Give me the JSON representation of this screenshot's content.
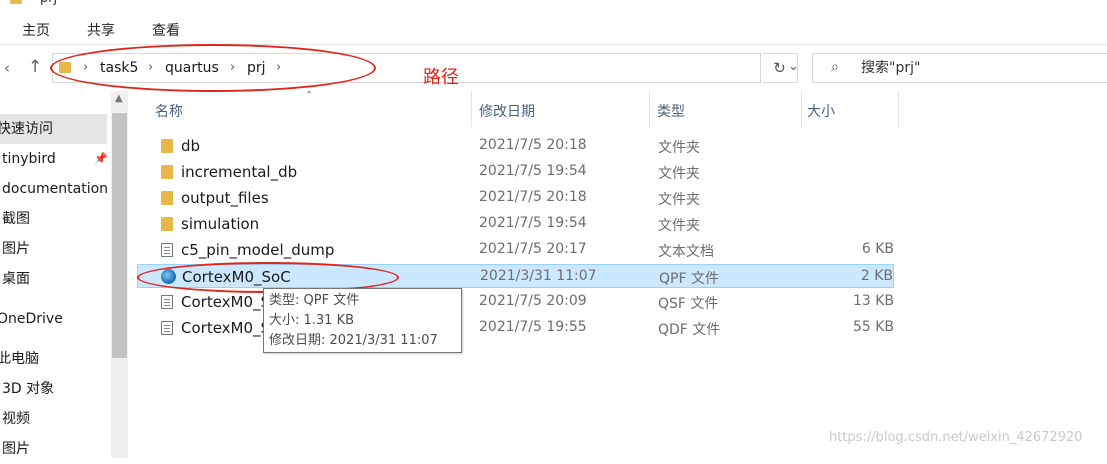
{
  "window": {
    "title": "prj"
  },
  "ribbon": {
    "tabs": [
      "主页",
      "共享",
      "查看"
    ]
  },
  "nav": {
    "back": "‹",
    "up": "↑"
  },
  "address": {
    "crumbs": [
      "task5",
      "quartus",
      "prj"
    ],
    "separator": "›",
    "dropdown": "⌄",
    "refresh": "↻"
  },
  "search": {
    "placeholder": "搜索\"prj\"",
    "icon": "search-icon"
  },
  "annotation": {
    "label": "路径",
    "color": "#e0251b"
  },
  "sidebar": {
    "items": [
      {
        "label": "快速访问",
        "selected": true
      },
      {
        "label": "tinybird",
        "pinned": true
      },
      {
        "label": "documentation"
      },
      {
        "label": "截图"
      },
      {
        "label": "图片"
      },
      {
        "label": "桌面"
      },
      {
        "label": "OneDrive"
      },
      {
        "label": "此电脑"
      },
      {
        "label": "3D 对象"
      },
      {
        "label": "视频"
      },
      {
        "label": "图片"
      }
    ]
  },
  "columns": {
    "name": "名称",
    "date": "修改日期",
    "type": "类型",
    "size": "大小"
  },
  "files": [
    {
      "name": "db",
      "date": "2021/7/5 20:18",
      "type": "文件夹",
      "size": "",
      "icon": "folder"
    },
    {
      "name": "incremental_db",
      "date": "2021/7/5 19:54",
      "type": "文件夹",
      "size": "",
      "icon": "folder"
    },
    {
      "name": "output_files",
      "date": "2021/7/5 20:18",
      "type": "文件夹",
      "size": "",
      "icon": "folder"
    },
    {
      "name": "simulation",
      "date": "2021/7/5 19:54",
      "type": "文件夹",
      "size": "",
      "icon": "folder"
    },
    {
      "name": "c5_pin_model_dump",
      "date": "2021/7/5 20:17",
      "type": "文本文档",
      "size": "6 KB",
      "icon": "doc"
    },
    {
      "name": "CortexM0_SoC",
      "date": "2021/3/31 11:07",
      "type": "QPF 文件",
      "size": "2 KB",
      "icon": "qpf",
      "selected": true
    },
    {
      "name": "CortexM0_S",
      "date": "2021/7/5 20:09",
      "type": "QSF 文件",
      "size": "13 KB",
      "icon": "doc"
    },
    {
      "name": "CortexM0_S",
      "date": "2021/7/5 19:55",
      "type": "QDF 文件",
      "size": "55 KB",
      "icon": "doc"
    }
  ],
  "tooltip": {
    "type_line": "类型: QPF 文件",
    "size_line": "大小: 1.31 KB",
    "date_line": "修改日期: 2021/3/31 11:07"
  },
  "watermark": "https://blog.csdn.net/weixin_42672920"
}
